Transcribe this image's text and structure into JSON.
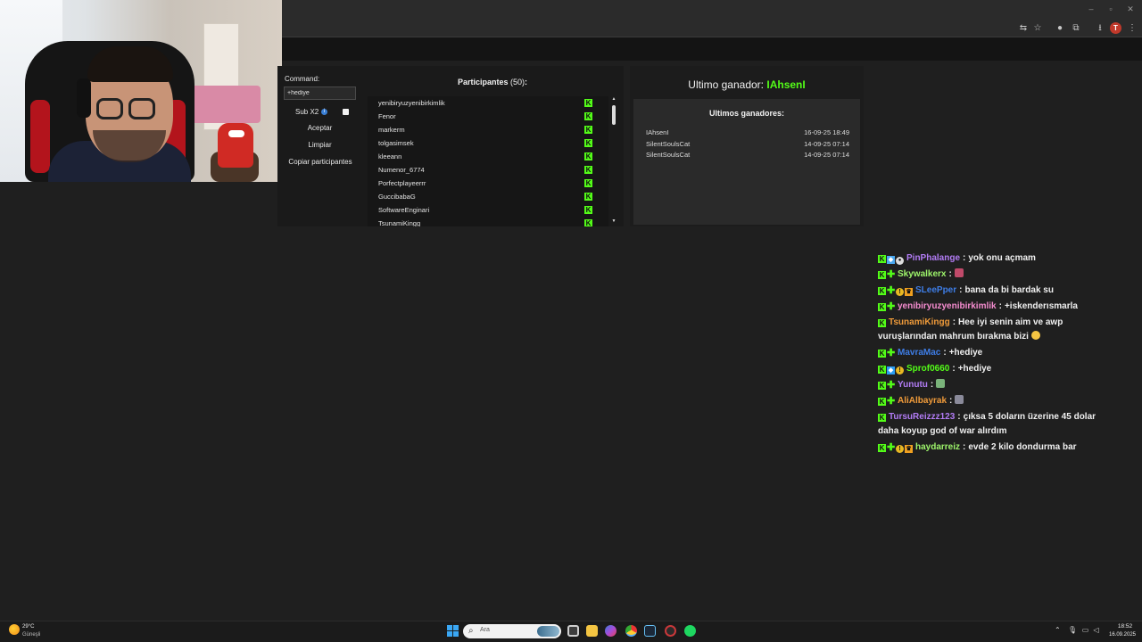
{
  "giveaway": {
    "command_label": "Command:",
    "command_value": "+hediye",
    "sub_label": "Sub X2",
    "sub_info_icon": "info-icon",
    "accept_label": "Aceptar",
    "clear_label": "Limpiar",
    "copy_label": "Copiar participantes",
    "participants_title": "Participantes",
    "participants_count": "(50)",
    "participants_colon": ":",
    "participants": [
      "yenibiryuzyenibirkimlik",
      "Fenor",
      "markerm",
      "tolgasimsek",
      "kleeann",
      "Numenor_6774",
      "Porfectplayeerrr",
      "GuccibabaG",
      "SoftwareEnginari",
      "TsunamiKingg"
    ]
  },
  "winners": {
    "last_winner_label": "Ultimo ganador:",
    "last_winner_name": "IAhsenI",
    "list_title": "Ultimos ganadores:",
    "list": [
      {
        "name": "IAhsenI",
        "date": "16-09-25 18:49"
      },
      {
        "name": "SilentSoulsCat",
        "date": "14-09-25 07:14"
      },
      {
        "name": "SilentSoulsCat",
        "date": "14-09-25 07:14"
      }
    ]
  },
  "chat": [
    {
      "badges": [
        "kick",
        "blue",
        "og"
      ],
      "user": "PinPhalange",
      "color": "#b27cf5",
      "text": "yok onu açmam"
    },
    {
      "badges": [
        "kick",
        "plus"
      ],
      "user": "Skywalkerx",
      "color": "#9ef56b",
      "text": ""
    },
    {
      "badges": [
        "kick",
        "plus",
        "gift",
        "crown"
      ],
      "user": "SLeePper",
      "color": "#3e7de6",
      "text": "bana da bi bardak su"
    },
    {
      "badges": [
        "kick",
        "plus"
      ],
      "user": "yenibiryuzyenibirkimlik",
      "color": "#f58ccf",
      "text": "+iskenderısmarla"
    },
    {
      "badges": [
        "kick"
      ],
      "user": "TsunamiKingg",
      "color": "#f09b3a",
      "text": "Hee iyi senin aim ve awp vuruşlarından mahrum bırakma bizi"
    },
    {
      "badges": [
        "kick",
        "plus"
      ],
      "user": "MavraMac",
      "color": "#3e7de6",
      "text": "+hediye"
    },
    {
      "badges": [
        "kick",
        "sub",
        "gift"
      ],
      "user": "Sprof0660",
      "color": "#53fc18",
      "text": "+hediye"
    },
    {
      "badges": [
        "kick",
        "plus"
      ],
      "user": "Yunutu",
      "color": "#b27cf5",
      "text": ""
    },
    {
      "badges": [
        "kick",
        "plus"
      ],
      "user": "AliAlbayrak",
      "color": "#f09b3a",
      "text": ""
    },
    {
      "badges": [
        "kick"
      ],
      "user": "TursuReizzz123",
      "color": "#b27cf5",
      "text": "çıksa 5 doların üzerine 45 dolar daha koyup god of war alırdım"
    },
    {
      "badges": [
        "kick",
        "plus",
        "gift",
        "crown"
      ],
      "user": "haydarreiz",
      "color": "#9ef56b",
      "text": "evde 2 kilo dondurma bar"
    }
  ],
  "chat_separator": ":",
  "taskbar": {
    "weather_temp": "29°C",
    "weather_desc": "Güneşli",
    "search_placeholder": "Ara",
    "time": "18:52",
    "date": "16.09.2025"
  },
  "colors": {
    "kick_green": "#53fc18",
    "panel_bg": "#1a1a1a",
    "page_bg": "#1f1f1f"
  }
}
